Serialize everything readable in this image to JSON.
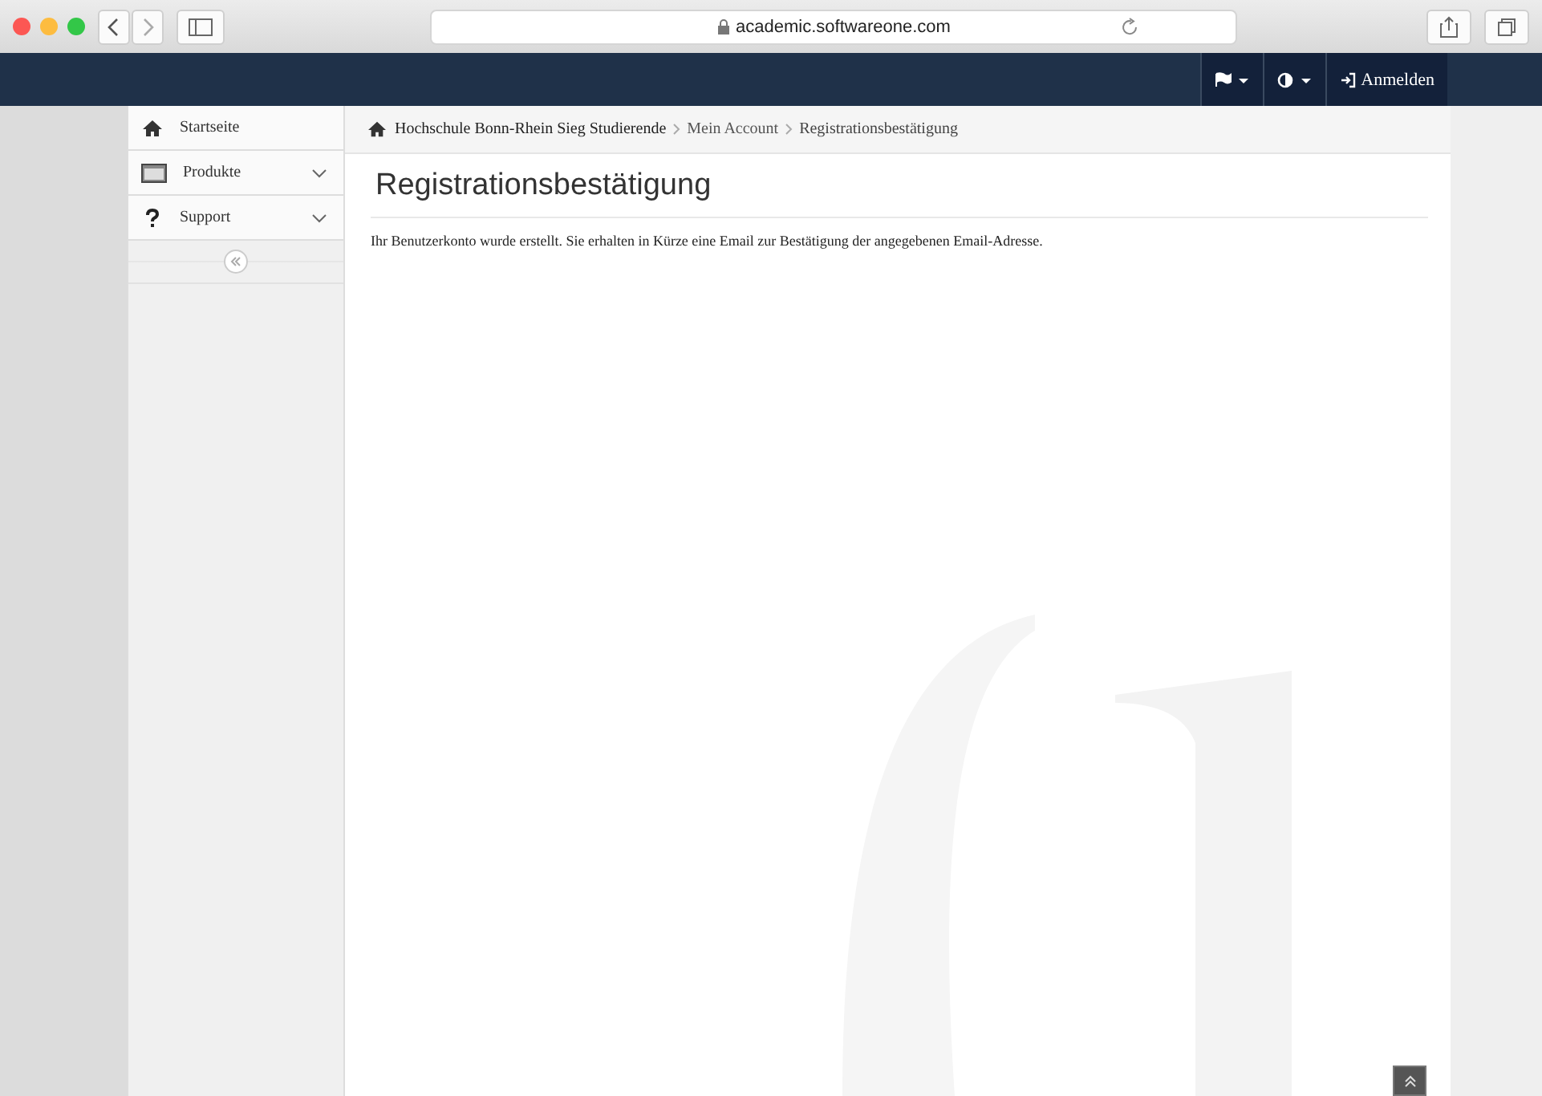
{
  "browser": {
    "address": "academic.softwareone.com"
  },
  "navbar": {
    "items": [
      {
        "kind": "flag"
      },
      {
        "kind": "contrast"
      },
      {
        "kind": "login",
        "label": "Anmelden"
      }
    ]
  },
  "sidebar": {
    "items": [
      {
        "label": "Startseite",
        "kind": "home",
        "expandable": false
      },
      {
        "label": "Produkte",
        "kind": "products",
        "expandable": true
      },
      {
        "label": "Support",
        "kind": "support",
        "expandable": true
      }
    ]
  },
  "breadcrumb": [
    {
      "label": "Hochschule Bonn-Rhein Sieg Studierende",
      "current": false
    },
    {
      "label": "Mein Account",
      "current": false
    },
    {
      "label": "Registrationsbestätigung",
      "current": true
    }
  ],
  "page": {
    "title": "Registrationsbestätigung",
    "message": "Ihr Benutzerkonto wurde erstellt. Sie erhalten in Kürze eine Email zur Bestätigung der angegebenen Email-Adresse."
  }
}
